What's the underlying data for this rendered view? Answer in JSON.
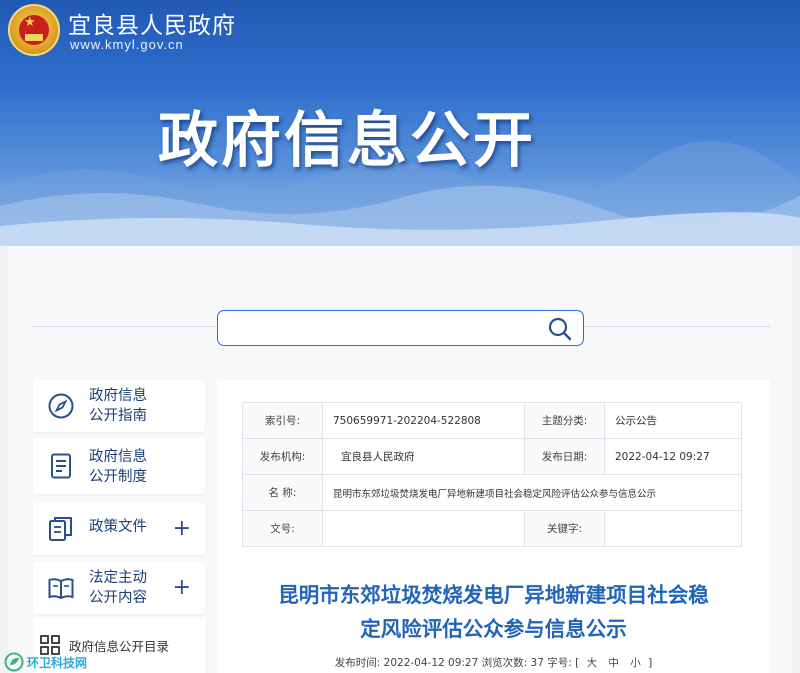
{
  "header": {
    "site_name": "宜良县人民政府",
    "site_url": "www.kmyl.gov.cn",
    "banner_title": "政府信息公开"
  },
  "search": {
    "value": "",
    "placeholder": ""
  },
  "sidebar": {
    "items": [
      {
        "line1": "政府信息",
        "line2": "公开指南",
        "icon": "compass-icon",
        "expandable": false
      },
      {
        "line1": "政府信息",
        "line2": "公开制度",
        "icon": "document-icon",
        "expandable": false
      },
      {
        "line1": "政策文件",
        "line2": "",
        "icon": "files-icon",
        "expandable": true,
        "plus": "+"
      },
      {
        "line1": "法定主动",
        "line2": "公开内容",
        "icon": "book-icon",
        "expandable": true,
        "plus": "+"
      }
    ],
    "sub_item": {
      "label": "政府信息公开目录",
      "icon": "grid-icon"
    }
  },
  "meta_table": {
    "index_label": "索引号:",
    "index_value": "750659971-202204-522808",
    "topic_label": "主题分类:",
    "topic_value": "公示公告",
    "org_label": "发布机构:",
    "org_value": "宜良县人民政府",
    "date_label": "发布日期:",
    "date_value": "2022-04-12 09:27",
    "name_label": "名 称:",
    "name_value": "昆明市东郊垃圾焚烧发电厂异地新建项目社会稳定风险评估公众参与信息公示",
    "docno_label": "文号:",
    "docno_value": "",
    "keyword_label": "关键字:",
    "keyword_value": ""
  },
  "article": {
    "title_line1": "昆明市东郊垃圾焚烧发电厂异地新建项目社会稳",
    "title_line2": "定风险评估公众参与信息公示",
    "publish_label": "发布时间:",
    "publish_time": "2022-04-12 09:27",
    "views_label": "浏览次数:",
    "views": "37",
    "font_label": "字号:",
    "font_open": "[",
    "font_large": "大",
    "font_medium": "中",
    "font_small": "小",
    "font_close": "]"
  },
  "watermark": {
    "text": "环卫科技网"
  },
  "colors": {
    "accent": "#2b69c9",
    "title_blue": "#2164b8",
    "nav_text": "#1d3f78"
  }
}
